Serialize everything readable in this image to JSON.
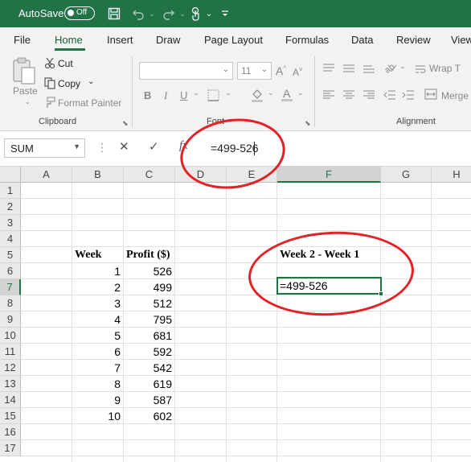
{
  "titlebar": {
    "autosave_label": "AutoSave",
    "autosave_state": "Off",
    "icons": [
      "save-icon",
      "undo-icon",
      "redo-icon",
      "touch-mode-icon",
      "customize-qat-icon"
    ]
  },
  "tabs": [
    "File",
    "Home",
    "Insert",
    "Draw",
    "Page Layout",
    "Formulas",
    "Data",
    "Review",
    "View"
  ],
  "active_tab": "Home",
  "ribbon": {
    "paste_label": "Paste",
    "cut_label": "Cut",
    "copy_label": "Copy",
    "format_painter_label": "Format Painter",
    "clipboard_group": "Clipboard",
    "font_size": "11",
    "bold": "B",
    "italic": "I",
    "underline": "U",
    "font_group": "Font",
    "wrap_text": "Wrap T",
    "merge": "Merge",
    "alignment_group": "Alignment"
  },
  "formula_bar": {
    "name_box": "SUM",
    "cancel": "✕",
    "enter": "✓",
    "fx": "fx",
    "formula": "=499-526"
  },
  "columns": [
    "A",
    "B",
    "C",
    "D",
    "E",
    "F",
    "G",
    "H"
  ],
  "rows": [
    "1",
    "2",
    "3",
    "4",
    "5",
    "6",
    "7",
    "8",
    "9",
    "10",
    "11",
    "12",
    "13",
    "14",
    "15",
    "16",
    "17"
  ],
  "sheet": {
    "header_week": "Week",
    "header_profit": "Profit ($)",
    "header_diff": "Week 2 - Week 1",
    "weeks": [
      "1",
      "2",
      "3",
      "4",
      "5",
      "6",
      "7",
      "8",
      "9",
      "10"
    ],
    "profits": [
      "526",
      "499",
      "512",
      "795",
      "681",
      "592",
      "542",
      "619",
      "587",
      "602"
    ],
    "editing_cell": "=499-526"
  },
  "colors": {
    "excel_green": "#217346",
    "annotation_red": "#e32127"
  }
}
